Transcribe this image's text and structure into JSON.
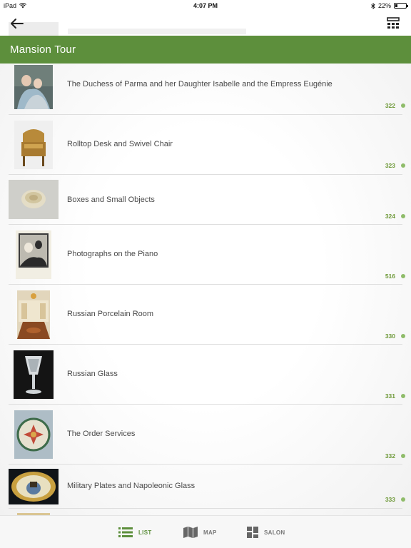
{
  "status_bar": {
    "device": "iPad",
    "time": "4:07 PM",
    "battery_text": "22%",
    "battery_level": 0.22
  },
  "header": {
    "title": "Mansion Tour"
  },
  "items": [
    {
      "title": "The Duchess of Parma and her Daughter Isabelle and the Empress Eugénie",
      "number": "322"
    },
    {
      "title": "Rolltop Desk and Swivel Chair",
      "number": "323"
    },
    {
      "title": "Boxes and Small Objects",
      "number": "324"
    },
    {
      "title": "Photographs on the Piano",
      "number": "516"
    },
    {
      "title": "Russian Porcelain Room",
      "number": "330"
    },
    {
      "title": "Russian Glass",
      "number": "331"
    },
    {
      "title": "The Order Services",
      "number": "332"
    },
    {
      "title": "Military Plates and Napoleonic Glass",
      "number": "333"
    }
  ],
  "tab_bar": {
    "list_label": "LIST",
    "map_label": "MAP",
    "salon_label": "SALON",
    "active": "LIST",
    "accent": "#5d8f3c"
  },
  "colors": {
    "header_bg": "#5d8f3c",
    "number_text": "#6f9a3a",
    "dot": "#8fbc6a"
  }
}
